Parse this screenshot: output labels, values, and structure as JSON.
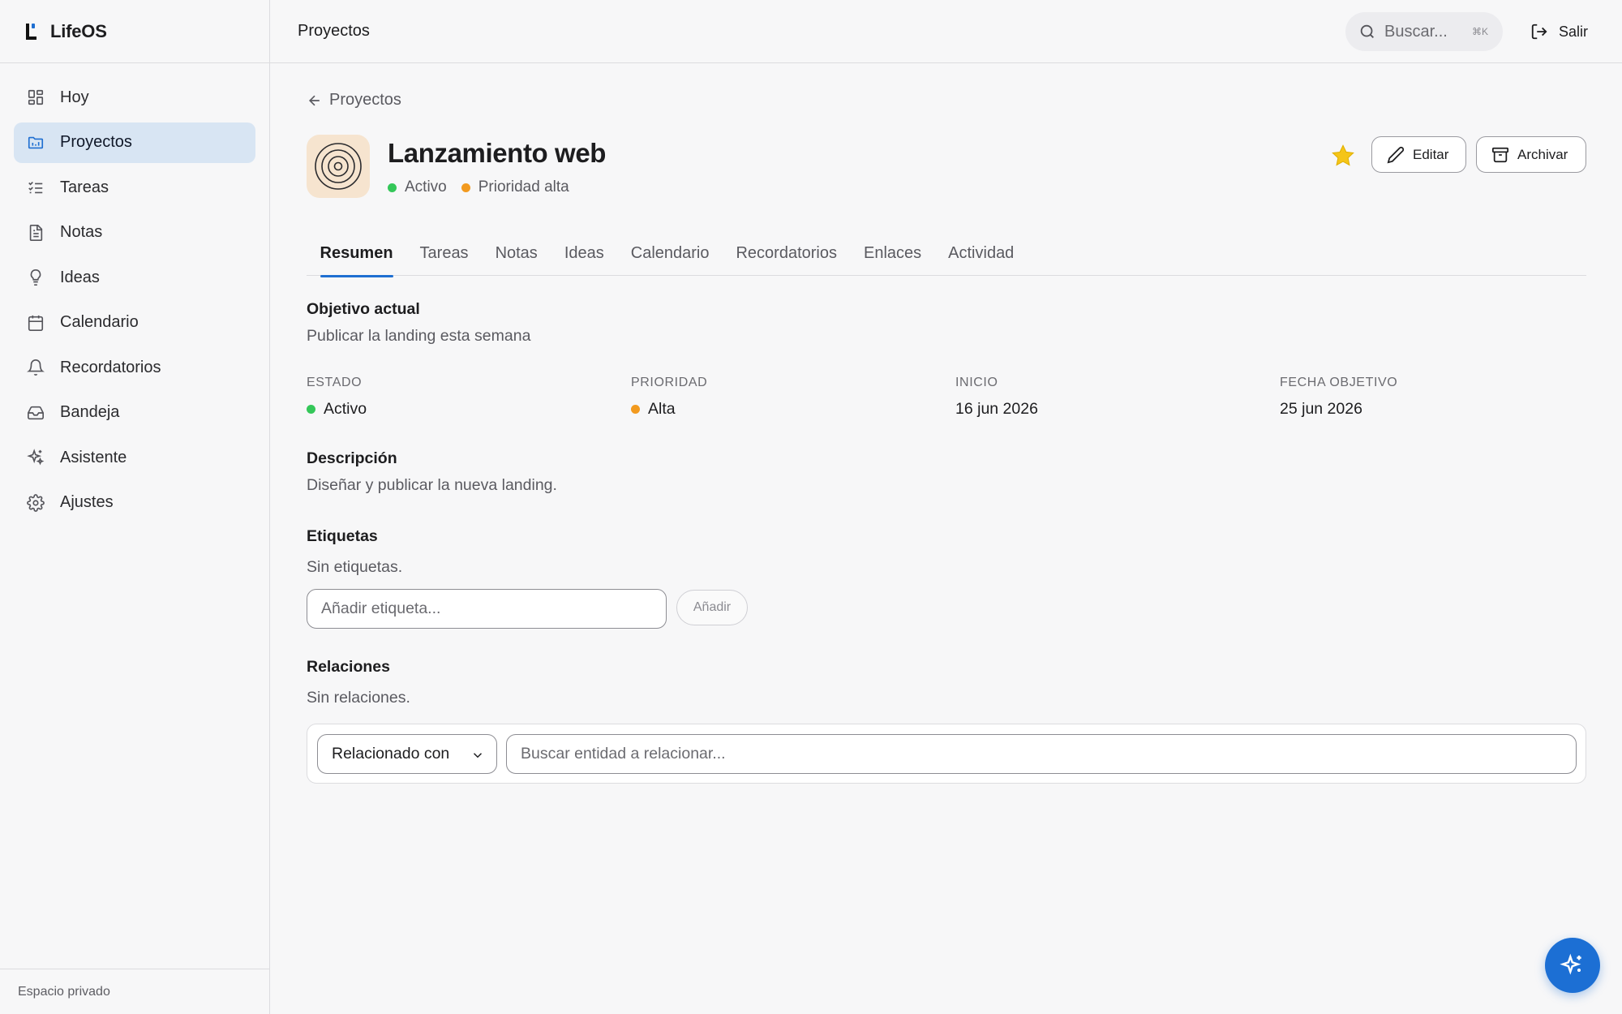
{
  "app": {
    "name": "LifeOS"
  },
  "sidebar": {
    "items": [
      {
        "label": "Hoy",
        "icon": "dashboard-icon",
        "active": false
      },
      {
        "label": "Proyectos",
        "icon": "folder-icon",
        "active": true
      },
      {
        "label": "Tareas",
        "icon": "checklist-icon",
        "active": false
      },
      {
        "label": "Notas",
        "icon": "note-icon",
        "active": false
      },
      {
        "label": "Ideas",
        "icon": "lightbulb-icon",
        "active": false
      },
      {
        "label": "Calendario",
        "icon": "calendar-icon",
        "active": false
      },
      {
        "label": "Recordatorios",
        "icon": "bell-icon",
        "active": false
      },
      {
        "label": "Bandeja",
        "icon": "inbox-icon",
        "active": false
      },
      {
        "label": "Asistente",
        "icon": "sparkles-icon",
        "active": false
      },
      {
        "label": "Ajustes",
        "icon": "gear-icon",
        "active": false
      }
    ],
    "footer": "Espacio privado"
  },
  "header": {
    "title": "Proyectos",
    "search_placeholder": "Buscar...",
    "search_shortcut": "⌘K",
    "logout_label": "Salir"
  },
  "project": {
    "back_label": "Proyectos",
    "title": "Lanzamiento web",
    "status": "Activo",
    "priority_label": "Prioridad alta",
    "favorite": true,
    "edit_label": "Editar",
    "archive_label": "Archivar"
  },
  "tabs": [
    {
      "label": "Resumen",
      "active": true
    },
    {
      "label": "Tareas",
      "active": false
    },
    {
      "label": "Notas",
      "active": false
    },
    {
      "label": "Ideas",
      "active": false
    },
    {
      "label": "Calendario",
      "active": false
    },
    {
      "label": "Recordatorios",
      "active": false
    },
    {
      "label": "Enlaces",
      "active": false
    },
    {
      "label": "Actividad",
      "active": false
    }
  ],
  "summary": {
    "objective_label": "Objetivo actual",
    "objective_text": "Publicar la landing esta semana",
    "stats": [
      {
        "key": "ESTADO",
        "value": "Activo",
        "dot_color": "#34c759"
      },
      {
        "key": "PRIORIDAD",
        "value": "Alta",
        "dot_color": "#f29a1f"
      },
      {
        "key": "INICIO",
        "value": "16 jun 2026"
      },
      {
        "key": "FECHA OBJETIVO",
        "value": "25 jun 2026"
      }
    ],
    "description_label": "Descripción",
    "description_text": "Diseñar y publicar la nueva landing.",
    "tags_label": "Etiquetas",
    "tags_empty": "Sin etiquetas.",
    "tag_placeholder": "Añadir etiqueta...",
    "tag_add_label": "Añadir",
    "relations_label": "Relaciones",
    "relations_empty": "Sin relaciones.",
    "relation_type": "Relacionado con",
    "relation_search_placeholder": "Buscar entidad a relacionar..."
  },
  "colors": {
    "accent": "#1f6fd1",
    "active_nav_bg": "#d8e5f3",
    "status_green": "#34c759",
    "priority_orange": "#f29a1f",
    "star": "#f5c518",
    "fab": "#1c6fd4"
  }
}
